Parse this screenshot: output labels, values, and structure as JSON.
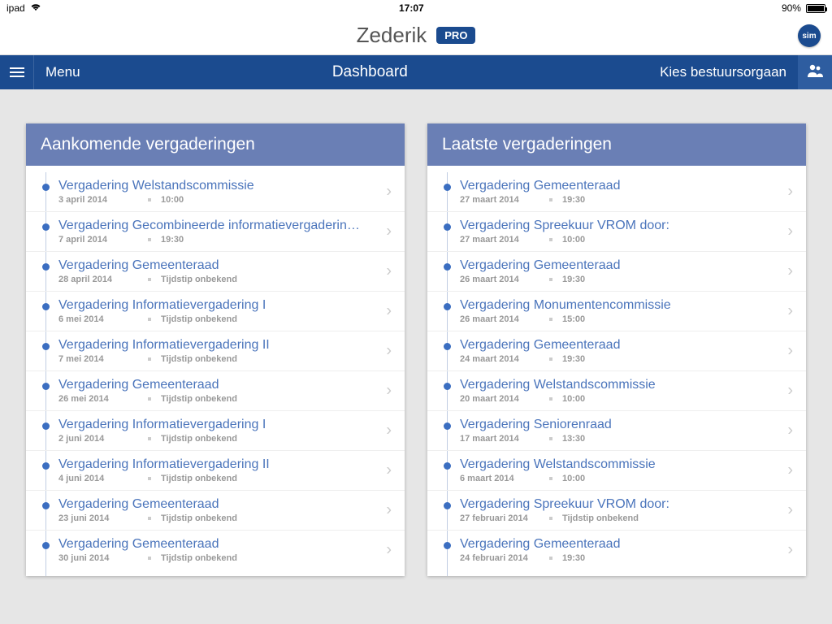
{
  "status_bar": {
    "device": "ipad",
    "time": "17:07",
    "battery_pct": "90%"
  },
  "header": {
    "title": "Zederik",
    "pro_label": "PRO",
    "logo_text": "sim"
  },
  "nav": {
    "menu_label": "Menu",
    "center_title": "Dashboard",
    "right_label": "Kies bestuursorgaan"
  },
  "panels": {
    "upcoming": {
      "title": "Aankomende vergaderingen",
      "items": [
        {
          "title": "Vergadering Welstandscommissie",
          "date": "3 april 2014",
          "time": "10:00"
        },
        {
          "title": "Vergadering Gecombineerde informatievergaderin…",
          "date": "7 april 2014",
          "time": "19:30"
        },
        {
          "title": "Vergadering Gemeenteraad",
          "date": "28 april 2014",
          "time": "Tijdstip onbekend"
        },
        {
          "title": "Vergadering Informatievergadering I",
          "date": "6 mei 2014",
          "time": "Tijdstip onbekend"
        },
        {
          "title": "Vergadering Informatievergadering II",
          "date": "7 mei 2014",
          "time": "Tijdstip onbekend"
        },
        {
          "title": "Vergadering Gemeenteraad",
          "date": "26 mei 2014",
          "time": "Tijdstip onbekend"
        },
        {
          "title": "Vergadering Informatievergadering I",
          "date": "2 juni 2014",
          "time": "Tijdstip onbekend"
        },
        {
          "title": "Vergadering Informatievergadering II",
          "date": "4 juni 2014",
          "time": "Tijdstip onbekend"
        },
        {
          "title": "Vergadering Gemeenteraad",
          "date": "23 juni 2014",
          "time": "Tijdstip onbekend"
        },
        {
          "title": "Vergadering Gemeenteraad",
          "date": "30 juni 2014",
          "time": "Tijdstip onbekend"
        }
      ]
    },
    "recent": {
      "title": "Laatste vergaderingen",
      "items": [
        {
          "title": "Vergadering Gemeenteraad",
          "date": "27 maart 2014",
          "time": "19:30"
        },
        {
          "title": "Vergadering Spreekuur VROM door:",
          "date": "27 maart 2014",
          "time": "10:00"
        },
        {
          "title": "Vergadering Gemeenteraad",
          "date": "26 maart 2014",
          "time": "19:30"
        },
        {
          "title": "Vergadering Monumentencommissie",
          "date": "26 maart 2014",
          "time": "15:00"
        },
        {
          "title": "Vergadering Gemeenteraad",
          "date": "24 maart 2014",
          "time": "19:30"
        },
        {
          "title": "Vergadering Welstandscommissie",
          "date": "20 maart 2014",
          "time": "10:00"
        },
        {
          "title": "Vergadering Seniorenraad",
          "date": "17 maart 2014",
          "time": "13:30"
        },
        {
          "title": "Vergadering Welstandscommissie",
          "date": "6 maart 2014",
          "time": "10:00"
        },
        {
          "title": "Vergadering Spreekuur VROM door:",
          "date": "27 februari 2014",
          "time": "Tijdstip onbekend"
        },
        {
          "title": "Vergadering Gemeenteraad",
          "date": "24 februari 2014",
          "time": "19:30"
        }
      ]
    }
  }
}
